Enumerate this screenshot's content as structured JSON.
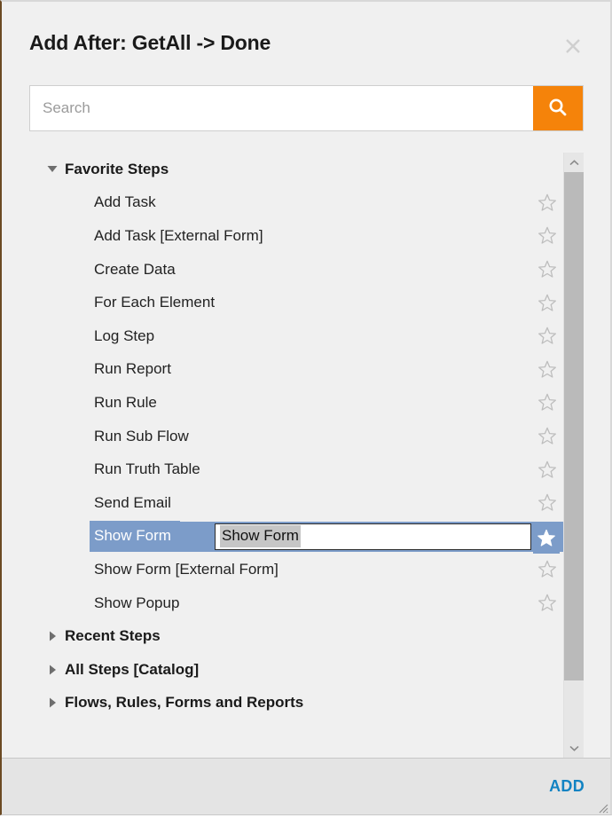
{
  "dialog": {
    "title": "Add After: GetAll -> Done",
    "close_icon": "close-icon"
  },
  "search": {
    "value": "",
    "placeholder": "Search",
    "button_icon": "search-icon",
    "button_color": "#f5830a"
  },
  "tree": {
    "groups": [
      {
        "label": "Favorite Steps",
        "expanded": true,
        "twisty": "chevron-down-icon",
        "items": [
          {
            "label": "Add Task",
            "favorite": false,
            "star_icon": "star-outline-icon"
          },
          {
            "label": "Add Task [External Form]",
            "favorite": false,
            "star_icon": "star-outline-icon"
          },
          {
            "label": "Create Data",
            "favorite": false,
            "star_icon": "star-outline-icon"
          },
          {
            "label": "For Each Element",
            "favorite": false,
            "star_icon": "star-outline-icon"
          },
          {
            "label": "Log Step",
            "favorite": false,
            "star_icon": "star-outline-icon"
          },
          {
            "label": "Run Report",
            "favorite": false,
            "star_icon": "star-outline-icon"
          },
          {
            "label": "Run Rule",
            "favorite": false,
            "star_icon": "star-outline-icon"
          },
          {
            "label": "Run Sub Flow",
            "favorite": false,
            "star_icon": "star-outline-icon"
          },
          {
            "label": "Run Truth Table",
            "favorite": false,
            "star_icon": "star-outline-icon"
          },
          {
            "label": "Send Email",
            "favorite": false,
            "star_icon": "star-outline-icon"
          },
          {
            "label": "Show Form",
            "favorite": true,
            "star_icon": "star-filled-icon",
            "selected": true,
            "editing": true,
            "edit_value": "Show Form"
          },
          {
            "label": "Show Form [External Form]",
            "favorite": false,
            "star_icon": "star-outline-icon"
          },
          {
            "label": "Show Popup",
            "favorite": false,
            "star_icon": "star-outline-icon"
          }
        ]
      },
      {
        "label": "Recent Steps",
        "expanded": false,
        "twisty": "chevron-right-icon",
        "items": []
      },
      {
        "label": "All Steps [Catalog]",
        "expanded": false,
        "twisty": "chevron-right-icon",
        "items": []
      },
      {
        "label": "Flows, Rules, Forms and Reports",
        "expanded": false,
        "twisty": "chevron-right-icon",
        "items": []
      }
    ]
  },
  "scrollbar": {
    "up_icon": "chevron-up-icon",
    "down_icon": "chevron-down-icon"
  },
  "footer": {
    "add_label": "ADD",
    "add_color": "#1283c3",
    "resize_grip": "resize-grip-icon"
  },
  "colors": {
    "selection_blue": "#7c9cc9",
    "accent_orange": "#f5830a",
    "link_blue": "#1283c3",
    "dialog_bg": "#f0f0f0",
    "footer_bg": "#e4e4e4"
  }
}
